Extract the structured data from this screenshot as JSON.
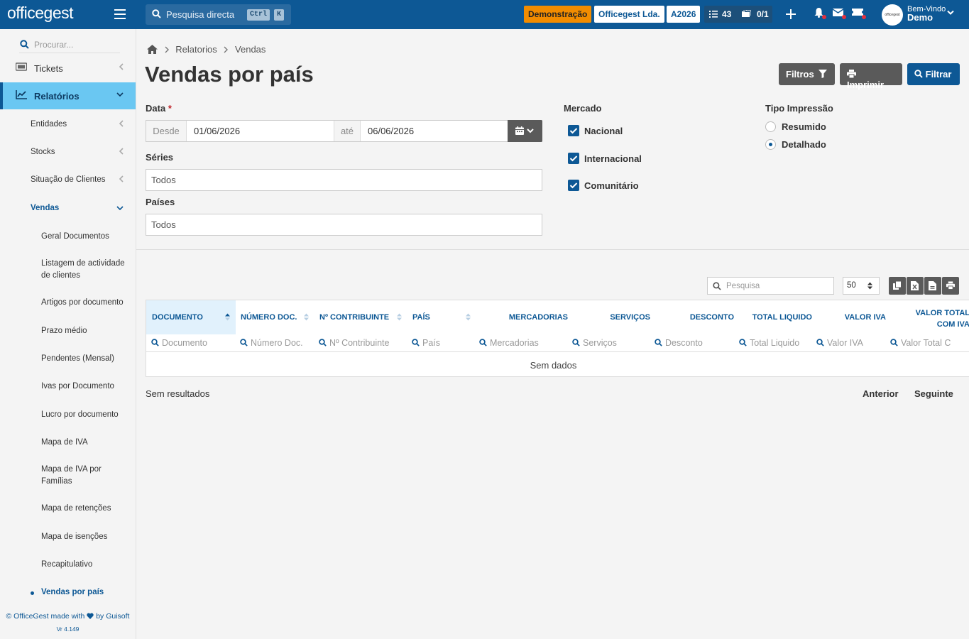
{
  "brand": {
    "logo": "officegest"
  },
  "topbar": {
    "search_placeholder": "Pesquisa directa",
    "shortcut_keys": [
      "Ctrl",
      "K"
    ],
    "demo_badge": "Demonstração",
    "company": "Officegest Lda.",
    "year": "A2026",
    "tasks_count": "43",
    "messages_count": "0/1",
    "avatar_text": "officegest",
    "welcome": "Bem-Vindo",
    "user": "Demo"
  },
  "sidebar": {
    "search_placeholder": "Procurar...",
    "items": [
      {
        "label": "Tickets"
      },
      {
        "label": "Relatórios"
      },
      {
        "label": "Entidades"
      },
      {
        "label": "Stocks"
      },
      {
        "label": "Situação de Clientes"
      },
      {
        "label": "Vendas"
      }
    ],
    "vendas_children": [
      "Geral Documentos",
      "Listagem de actividade de clientes",
      "Artigos por documento",
      "Prazo médio",
      "Pendentes (Mensal)",
      "Ivas por Documento",
      "Lucro por documento",
      "Mapa de IVA",
      "Mapa de IVA por Famílias",
      "Mapa de retenções",
      "Mapa de isenções",
      "Recapitulativo",
      "Vendas por país"
    ],
    "footer_prefix": "© OfficeGest made with",
    "footer_suffix": "by Guisoft",
    "version": "Vr 4.149"
  },
  "breadcrumb": [
    "Relatorios",
    "Vendas"
  ],
  "page": {
    "title": "Vendas por país"
  },
  "actions": {
    "filtros": "Filtros",
    "imprimir": "Imprimir",
    "filtrar": "Filtrar"
  },
  "form": {
    "date_label": "Data",
    "required_mark": "*",
    "from_addon": "Desde",
    "from_value": "01/06/2026",
    "to_addon": "até",
    "to_value": "06/06/2026",
    "series_label": "Séries",
    "series_value": "Todos",
    "countries_label": "Países",
    "countries_value": "Todos",
    "market_label": "Mercado",
    "markets": [
      {
        "label": "Nacional",
        "checked": true
      },
      {
        "label": "Internacional",
        "checked": true
      },
      {
        "label": "Comunitário",
        "checked": true
      }
    ],
    "print_type_label": "Tipo Impressão",
    "print_types": [
      {
        "label": "Resumido",
        "selected": false
      },
      {
        "label": "Detalhado",
        "selected": true
      }
    ]
  },
  "table": {
    "search_placeholder": "Pesquisa",
    "page_size": "50",
    "columns": [
      {
        "header": "Documento",
        "filter": "Documento"
      },
      {
        "header": "Número Doc.",
        "filter": "Número Doc."
      },
      {
        "header": "Nº Contribuinte",
        "filter": "Nº Contribuinte"
      },
      {
        "header": "País",
        "filter": "País"
      },
      {
        "header": "Mercadorias",
        "filter": "Mercadorias"
      },
      {
        "header": "Serviços",
        "filter": "Serviços"
      },
      {
        "header": "Desconto",
        "filter": "Desconto"
      },
      {
        "header": "Total Liquido",
        "filter": "Total Liquido"
      },
      {
        "header": "Valor IVA",
        "filter": "Valor IVA"
      },
      {
        "header": "Valor Total com IVA",
        "filter": "Valor Total C"
      }
    ],
    "empty": "Sem dados"
  },
  "pagination": {
    "status": "Sem resultados",
    "prev": "Anterior",
    "next": "Seguinte"
  },
  "colors": {
    "primary": "#0d5895",
    "accent": "#6ac7f2",
    "demo": "#f28c00",
    "dark_button": "#5a5a5a"
  }
}
